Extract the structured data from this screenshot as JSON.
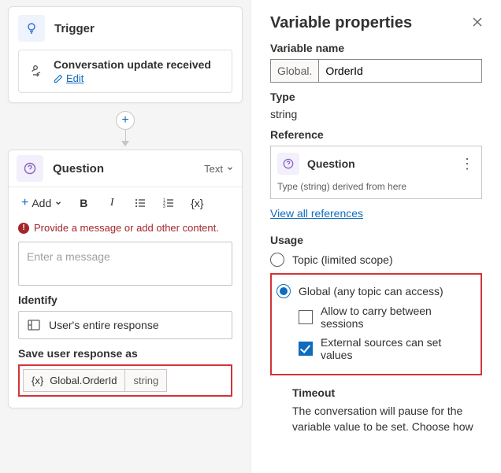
{
  "canvas": {
    "trigger": {
      "title": "Trigger",
      "event_title": "Conversation update received",
      "edit_label": "Edit"
    },
    "question": {
      "title": "Question",
      "type_label": "Text",
      "add_label": "Add",
      "error_msg": "Provide a message or add other content.",
      "placeholder": "Enter a message",
      "identify_label": "Identify",
      "identify_value": "User's entire response",
      "save_as_label": "Save user response as",
      "save_var": "Global.OrderId",
      "save_type": "string"
    }
  },
  "panel": {
    "title": "Variable properties",
    "name_label": "Variable name",
    "name_prefix": "Global.",
    "name_value": "OrderId",
    "type_label": "Type",
    "type_value": "string",
    "reference_label": "Reference",
    "reference_title": "Question",
    "reference_note": "Type (string) derived from here",
    "view_all": "View all references",
    "usage_label": "Usage",
    "usage_topic": "Topic (limited scope)",
    "usage_global": "Global (any topic can access)",
    "carry_sessions": "Allow to carry between sessions",
    "external_set": "External sources can set values",
    "timeout_label": "Timeout",
    "timeout_body": "The conversation will pause for the variable value to be set. Choose how"
  }
}
